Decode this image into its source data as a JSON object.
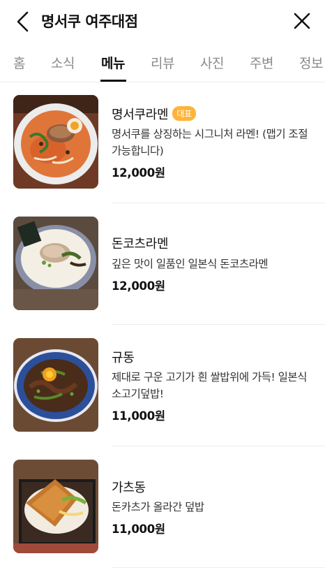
{
  "header": {
    "title": "명서쿠 여주대점"
  },
  "tabs": [
    {
      "label": "홈",
      "active": false
    },
    {
      "label": "소식",
      "active": false
    },
    {
      "label": "메뉴",
      "active": true
    },
    {
      "label": "리뷰",
      "active": false
    },
    {
      "label": "사진",
      "active": false
    },
    {
      "label": "주변",
      "active": false
    },
    {
      "label": "정보",
      "active": false
    }
  ],
  "menu": [
    {
      "name": "명서쿠라멘",
      "badge": "대표",
      "description": "명서쿠를 상징하는 시그니처 라멘! (맵기 조절 가능합니다)",
      "price": "12,000원"
    },
    {
      "name": "돈코츠라멘",
      "badge": "",
      "description": "깊은 맛이 일품인 일본식 돈코츠라멘",
      "price": "12,000원"
    },
    {
      "name": "규동",
      "badge": "",
      "description": "제대로 구운 고기가 흰 쌀밥위에 가득! 일본식 소고기덮밥!",
      "price": "11,000원"
    },
    {
      "name": "가츠동",
      "badge": "",
      "description": "돈카츠가 올라간 덮밥",
      "price": "11,000원"
    }
  ],
  "colors": {
    "badge": "#ffb338",
    "active_tab": "#111111",
    "inactive_tab": "#8a8a8a",
    "divider": "#eeeeee"
  }
}
